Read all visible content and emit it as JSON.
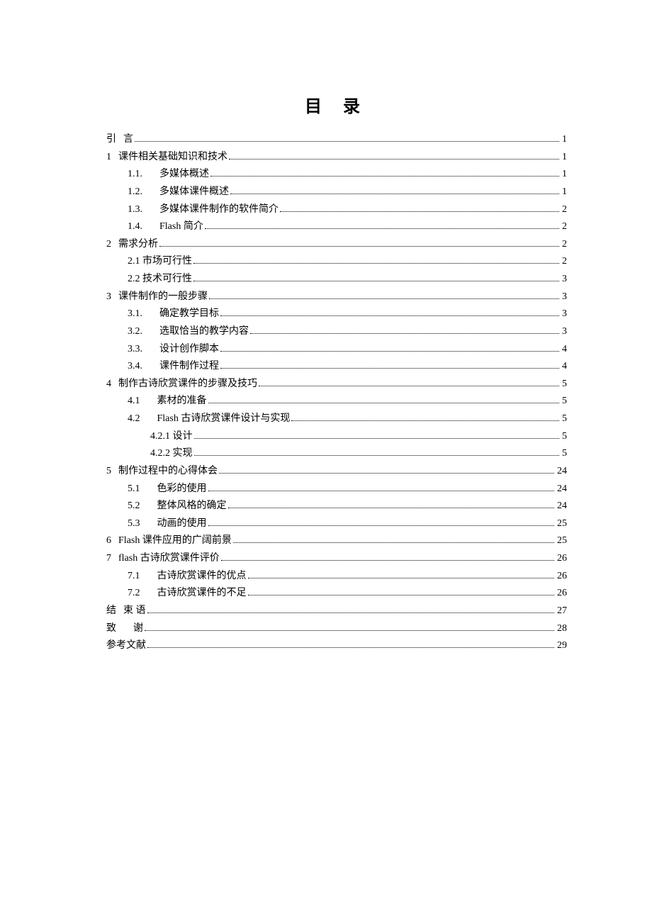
{
  "title": "目  录",
  "entries": [
    {
      "level": 0,
      "num": "引",
      "label": "言",
      "page": "1",
      "gap": "sm"
    },
    {
      "level": 0,
      "num": "1",
      "label": "课件相关基础知识和技术",
      "page": "1",
      "gap": "sm"
    },
    {
      "level": 1,
      "num": "1.1.",
      "label": "多媒体概述",
      "page": "1",
      "gap": "lg"
    },
    {
      "level": 1,
      "num": "1.2.",
      "label": "多媒体课件概述",
      "page": "1",
      "gap": "lg"
    },
    {
      "level": 1,
      "num": "1.3.",
      "label": "多媒体课件制作的软件简介",
      "page": "2",
      "gap": "lg"
    },
    {
      "level": 1,
      "num": "1.4.",
      "label": "Flash 简介",
      "page": "2",
      "gap": "lg"
    },
    {
      "level": 0,
      "num": "2",
      "label": "需求分析",
      "page": "2",
      "gap": "sm"
    },
    {
      "level": 1,
      "num": "",
      "label": "2.1 市场可行性",
      "page": "2",
      "gap": "no"
    },
    {
      "level": 1,
      "num": "",
      "label": "2.2 技术可行性",
      "page": "3",
      "gap": "no"
    },
    {
      "level": 0,
      "num": "3",
      "label": "课件制作的一般步骤",
      "page": "3",
      "gap": "sm"
    },
    {
      "level": 1,
      "num": "3.1.",
      "label": "确定教学目标",
      "page": "3",
      "gap": "lg"
    },
    {
      "level": 1,
      "num": "3.2.",
      "label": "选取恰当的教学内容",
      "page": "3",
      "gap": "lg"
    },
    {
      "level": 1,
      "num": "3.3.",
      "label": "设计创作脚本",
      "page": "4",
      "gap": "lg"
    },
    {
      "level": 1,
      "num": "3.4.",
      "label": "课件制作过程",
      "page": "4",
      "gap": "lg"
    },
    {
      "level": 0,
      "num": "4",
      "label": "制作古诗欣赏课件的步骤及技巧",
      "page": "5",
      "gap": "sm"
    },
    {
      "level": 1,
      "num": "4.1",
      "label": "素材的准备",
      "page": "5",
      "gap": "lg"
    },
    {
      "level": 1,
      "num": "4.2",
      "label": "Flash 古诗欣赏课件设计与实现",
      "page": "5",
      "gap": "lg"
    },
    {
      "level": 2,
      "num": "",
      "label": "4.2.1 设计",
      "page": "5",
      "gap": "no"
    },
    {
      "level": 2,
      "num": "",
      "label": "4.2.2 实现",
      "page": "5",
      "gap": "no"
    },
    {
      "level": 0,
      "num": "5",
      "label": "制作过程中的心得体会",
      "page": "24",
      "gap": "sm"
    },
    {
      "level": 1,
      "num": "5.1",
      "label": "色彩的使用",
      "page": "24",
      "gap": "lg"
    },
    {
      "level": 1,
      "num": "5.2",
      "label": "整体风格的确定",
      "page": "24",
      "gap": "lg"
    },
    {
      "level": 1,
      "num": "5.3",
      "label": "动画的使用",
      "page": "25",
      "gap": "lg"
    },
    {
      "level": 0,
      "num": "6",
      "label": "Flash 课件应用的广阔前景",
      "page": "25",
      "gap": "sm"
    },
    {
      "level": 0,
      "num": "7",
      "label": "flash 古诗欣赏课件评价",
      "page": "26",
      "gap": "sm"
    },
    {
      "level": 1,
      "num": "7.1",
      "label": "古诗欣赏课件的优点",
      "page": "26",
      "gap": "lg"
    },
    {
      "level": 1,
      "num": "7.2",
      "label": "古诗欣赏课件的不足",
      "page": "26",
      "gap": "lg"
    },
    {
      "level": 0,
      "num": "结",
      "label": "束  语",
      "page": "27",
      "gap": "sm"
    },
    {
      "level": 0,
      "num": "致",
      "label": "谢",
      "page": "28",
      "gap": "lg"
    },
    {
      "level": 0,
      "num": "",
      "label": "参考文献",
      "page": "29",
      "gap": "no"
    }
  ]
}
